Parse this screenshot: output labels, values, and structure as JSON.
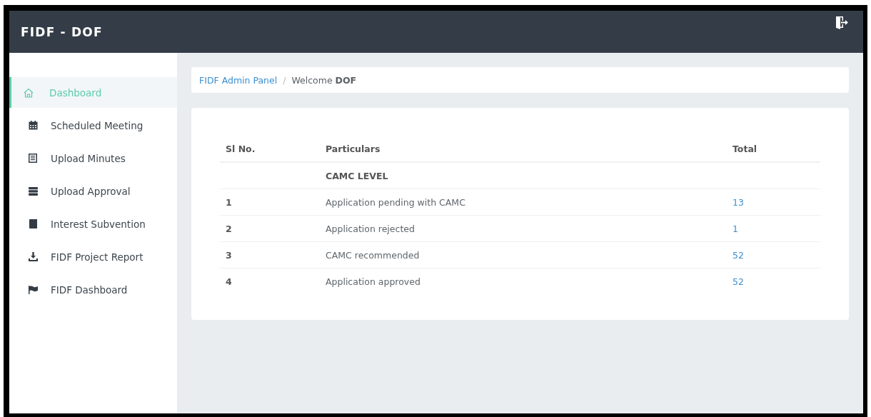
{
  "header": {
    "title": "FIDF - DOF"
  },
  "sidebar": {
    "items": [
      {
        "label": "Dashboard",
        "selected": true
      },
      {
        "label": "Scheduled Meeting",
        "selected": false
      },
      {
        "label": "Upload Minutes",
        "selected": false
      },
      {
        "label": "Upload Approval",
        "selected": false
      },
      {
        "label": "Interest Subvention",
        "selected": false
      },
      {
        "label": "FIDF Project Report",
        "selected": false
      },
      {
        "label": "FIDF Dashboard",
        "selected": false
      }
    ]
  },
  "breadcrumb": {
    "link": "FIDF Admin Panel",
    "separator": "/",
    "current": "Welcome **DOF**"
  },
  "table": {
    "columns": [
      "Sl No.",
      "Particulars",
      "Total"
    ],
    "rows": [
      {
        "kind": "group",
        "particulars": "CAMC LEVEL"
      },
      {
        "kind": "data",
        "sl_no": "1",
        "particulars": "Application pending with CAMC",
        "total": "13"
      },
      {
        "kind": "data",
        "sl_no": "2",
        "particulars": "Application rejected",
        "total": "1"
      },
      {
        "kind": "data",
        "sl_no": "3",
        "particulars": "CAMC recommended",
        "total": "52"
      },
      {
        "kind": "data",
        "sl_no": "4",
        "particulars": "Application approved",
        "total": "52"
      }
    ]
  }
}
